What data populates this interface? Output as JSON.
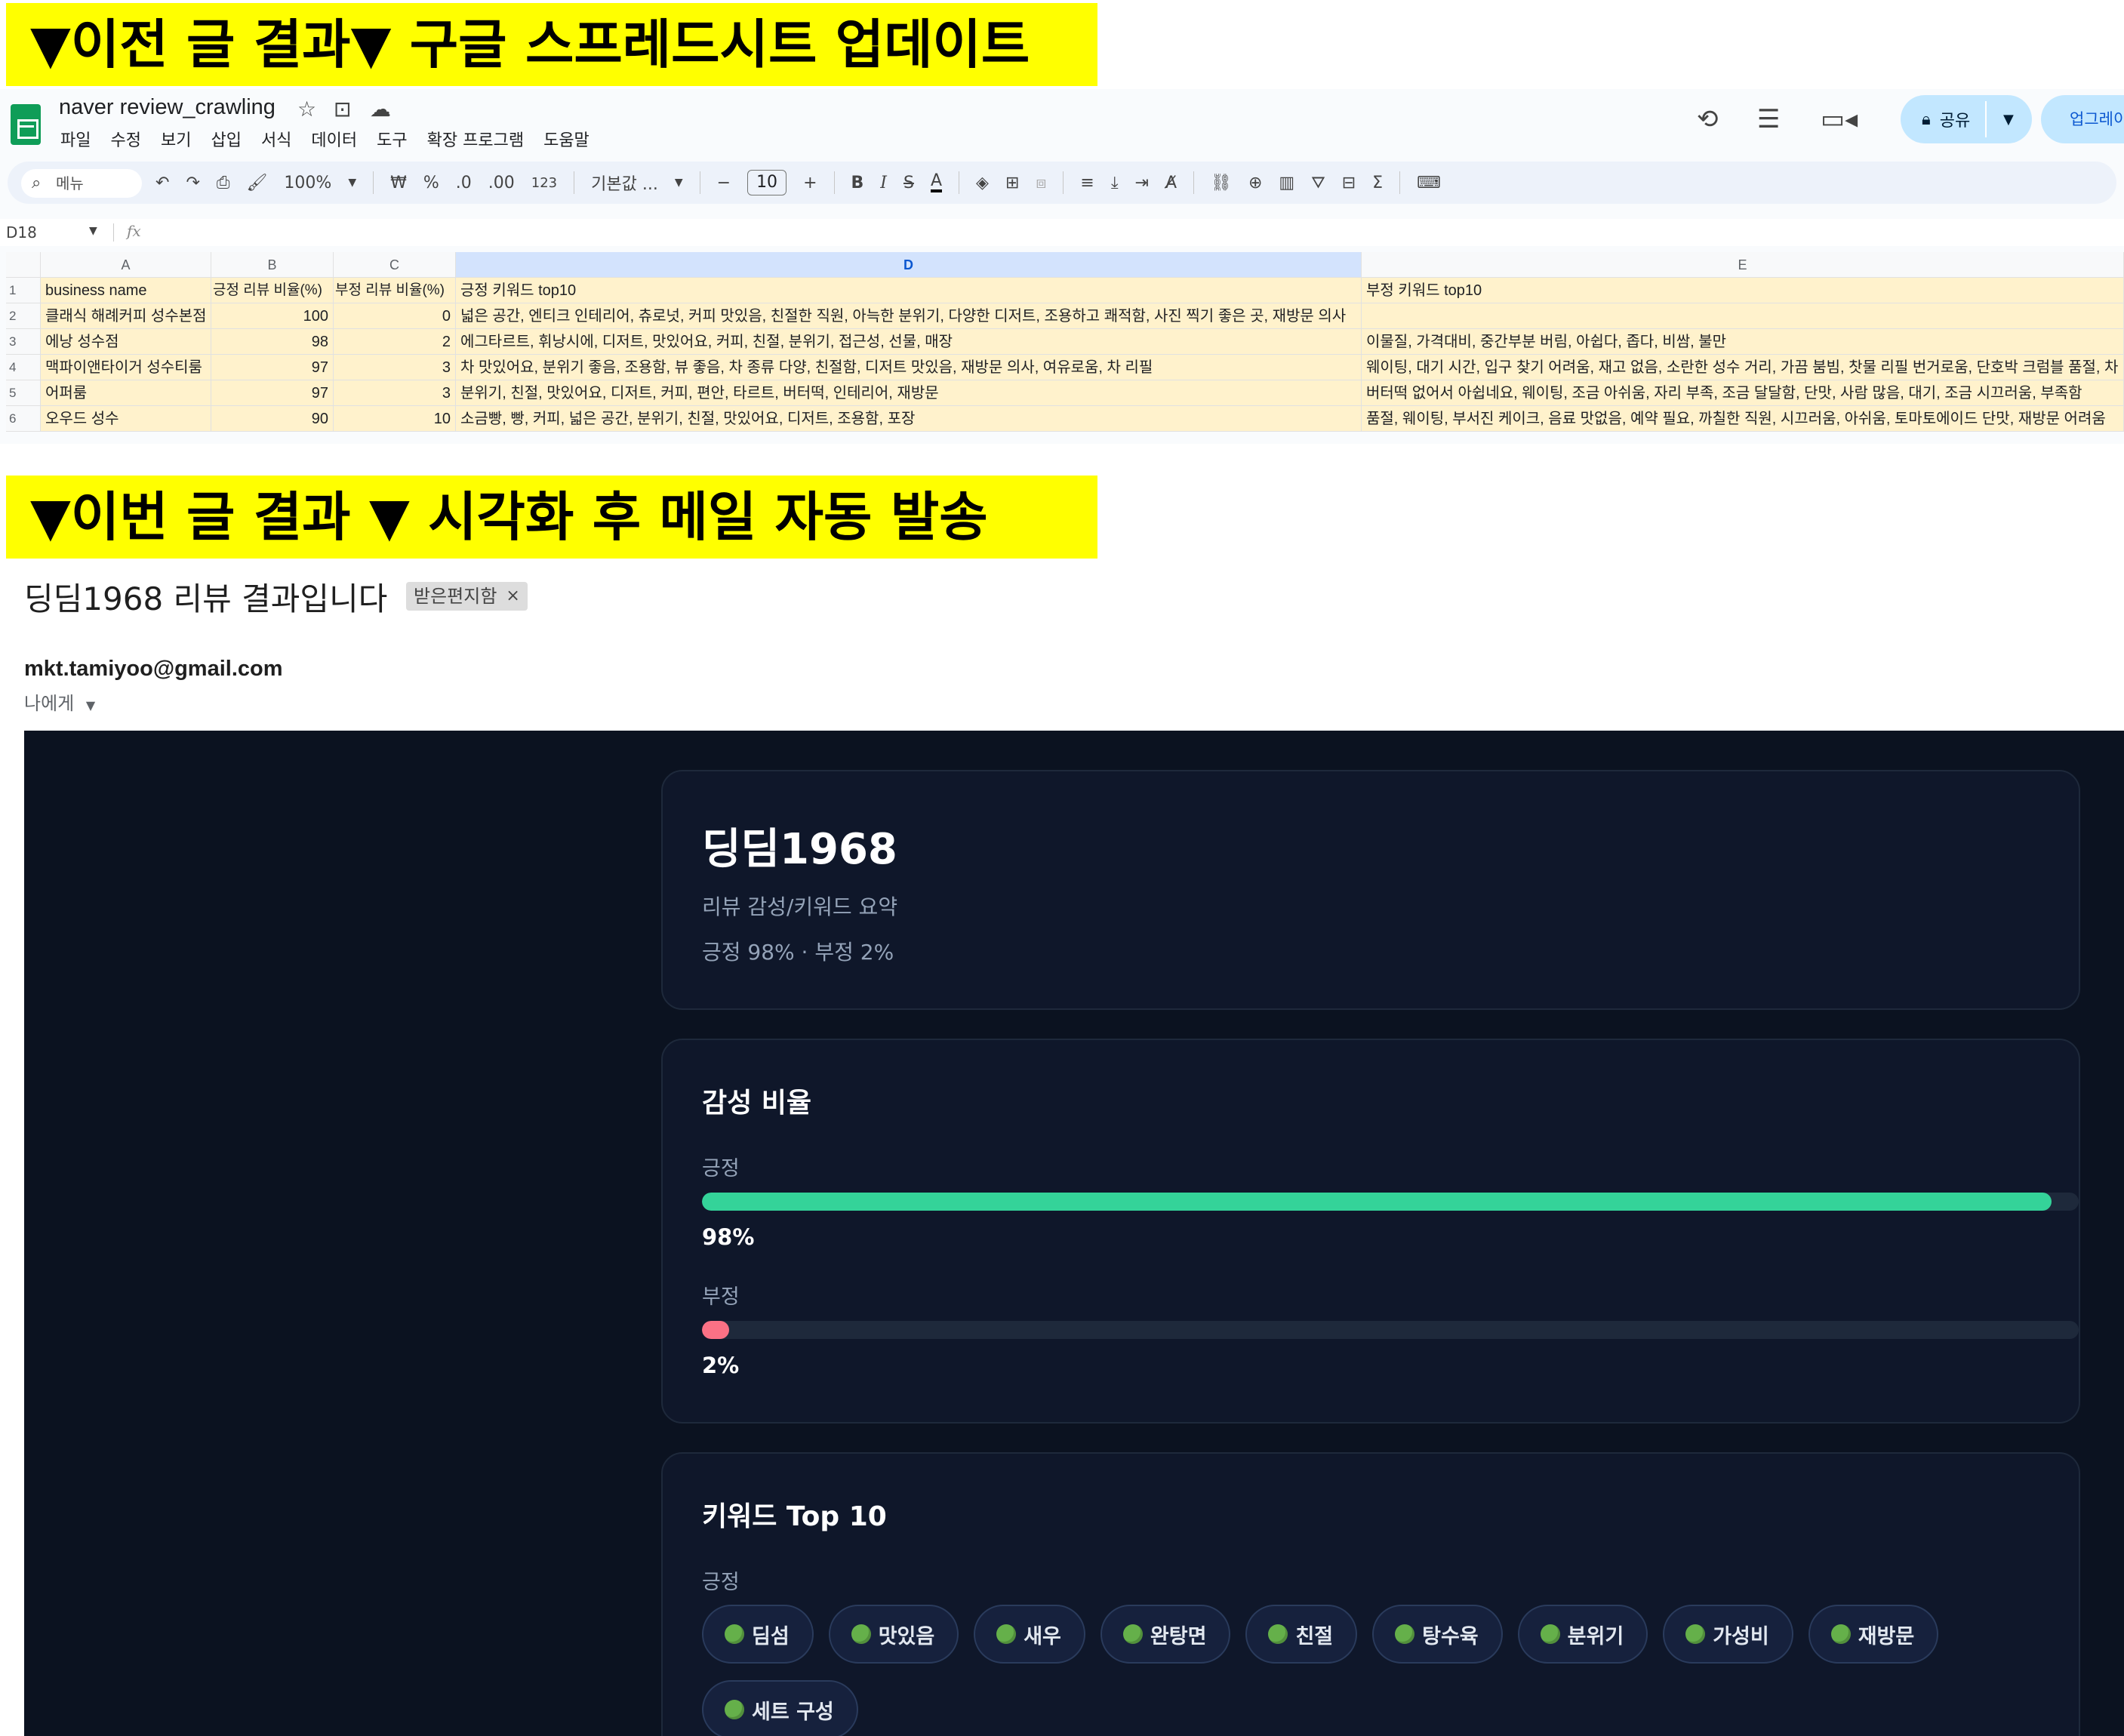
{
  "banners": {
    "top": "▼이전 글 결과▼ 구글 스프레드시트 업데이트",
    "bottom": "▼이번 글 결과 ▼ 시각화 후 메일 자동 발송"
  },
  "sheets": {
    "title": "naver review_crawling",
    "menu": [
      "파일",
      "수정",
      "보기",
      "삽입",
      "서식",
      "데이터",
      "도구",
      "확장 프로그램",
      "도움말"
    ],
    "share_label": "공유",
    "upgrade_label": "업그레이",
    "toolbar": {
      "search_placeholder": "메뉴",
      "zoom": "100%",
      "currency": "₩",
      "percent": "%",
      "dec_less": ".0",
      "dec_more": ".00",
      "format_123": "123",
      "font": "기본값 ...",
      "font_size": "10",
      "bold": "B",
      "italic": "I",
      "strike": "S",
      "text_color": "A"
    },
    "cell_ref": "D18",
    "fx": "fx",
    "columns": [
      "A",
      "B",
      "C",
      "D",
      "E"
    ],
    "rows": [
      {
        "n": "1",
        "a": "business name",
        "b": "긍정 리뷰 비율(%)",
        "c": "부정 리뷰 비율(%)",
        "d": "긍정 키워드 top10",
        "e": "부정 키워드 top10"
      },
      {
        "n": "2",
        "a": "클래식 해례커피 성수본점",
        "b": "100",
        "c": "0",
        "d": "넓은 공간, 엔티크 인테리어, 츄로넛, 커피 맛있음, 친절한 직원, 아늑한 분위기, 다양한 디저트, 조용하고 쾌적함, 사진 찍기 좋은 곳, 재방문 의사",
        "e": ""
      },
      {
        "n": "3",
        "a": "에낭 성수점",
        "b": "98",
        "c": "2",
        "d": "에그타르트, 휘낭시에, 디저트, 맛있어요, 커피, 친절, 분위기, 접근성, 선물, 매장",
        "e": "이물질, 가격대비, 중간부분 버림, 아쉽다, 좁다, 비쌈, 불만"
      },
      {
        "n": "4",
        "a": "맥파이앤타이거 성수티룸",
        "b": "97",
        "c": "3",
        "d": "차 맛있어요, 분위기 좋음, 조용함, 뷰 좋음, 차 종류 다양, 친절함, 디저트 맛있음, 재방문 의사, 여유로움, 차 리필",
        "e": "웨이팅, 대기 시간, 입구 찾기 어려움, 재고 없음, 소란한 성수 거리, 가끔 붐빔, 찻물 리필 번거로움, 단호박 크럼블 품절, 차"
      },
      {
        "n": "5",
        "a": "어퍼룸",
        "b": "97",
        "c": "3",
        "d": "분위기, 친절, 맛있어요, 디저트, 커피, 편안, 타르트, 버터떡, 인테리어, 재방문",
        "e": "버터떡 없어서 아쉽네요, 웨이팅, 조금 아쉬움, 자리 부족, 조금 달달함, 단맛, 사람 많음, 대기, 조금 시끄러움, 부족함"
      },
      {
        "n": "6",
        "a": "오우드 성수",
        "b": "90",
        "c": "10",
        "d": "소금빵, 빵, 커피, 넓은 공간, 분위기, 친절, 맛있어요, 디저트, 조용함, 포장",
        "e": "품절, 웨이팅, 부서진 케이크, 음료 맛없음, 예약 필요, 까칠한 직원, 시끄러움, 아쉬움, 토마토에이드 단맛, 재방문 어려움"
      }
    ]
  },
  "email": {
    "subject": "딩딤1968 리뷰 결과입니다",
    "inbox_label": "받은편지함",
    "sender": "mkt.tamiyoo@gmail.com",
    "to": "나에게",
    "card1": {
      "title": "딩딤1968",
      "subtitle": "리뷰 감성/키워드 요약",
      "stat": "긍정 98% · 부정 2%"
    },
    "card2": {
      "title": "감성 비율",
      "positive_label": "긍정",
      "positive_pct": "98%",
      "positive_value": 0.98,
      "negative_label": "부정",
      "negative_pct": "2%",
      "negative_value": 0.02,
      "positive_color": "#34d399",
      "negative_color": "#fb7185"
    },
    "card3": {
      "title": "키워드 Top 10",
      "positive_label": "긍정",
      "keywords": [
        "딤섬",
        "맛있음",
        "새우",
        "완탕면",
        "친절",
        "탕수육",
        "분위기",
        "가성비",
        "재방문",
        "세트 구성"
      ]
    }
  }
}
